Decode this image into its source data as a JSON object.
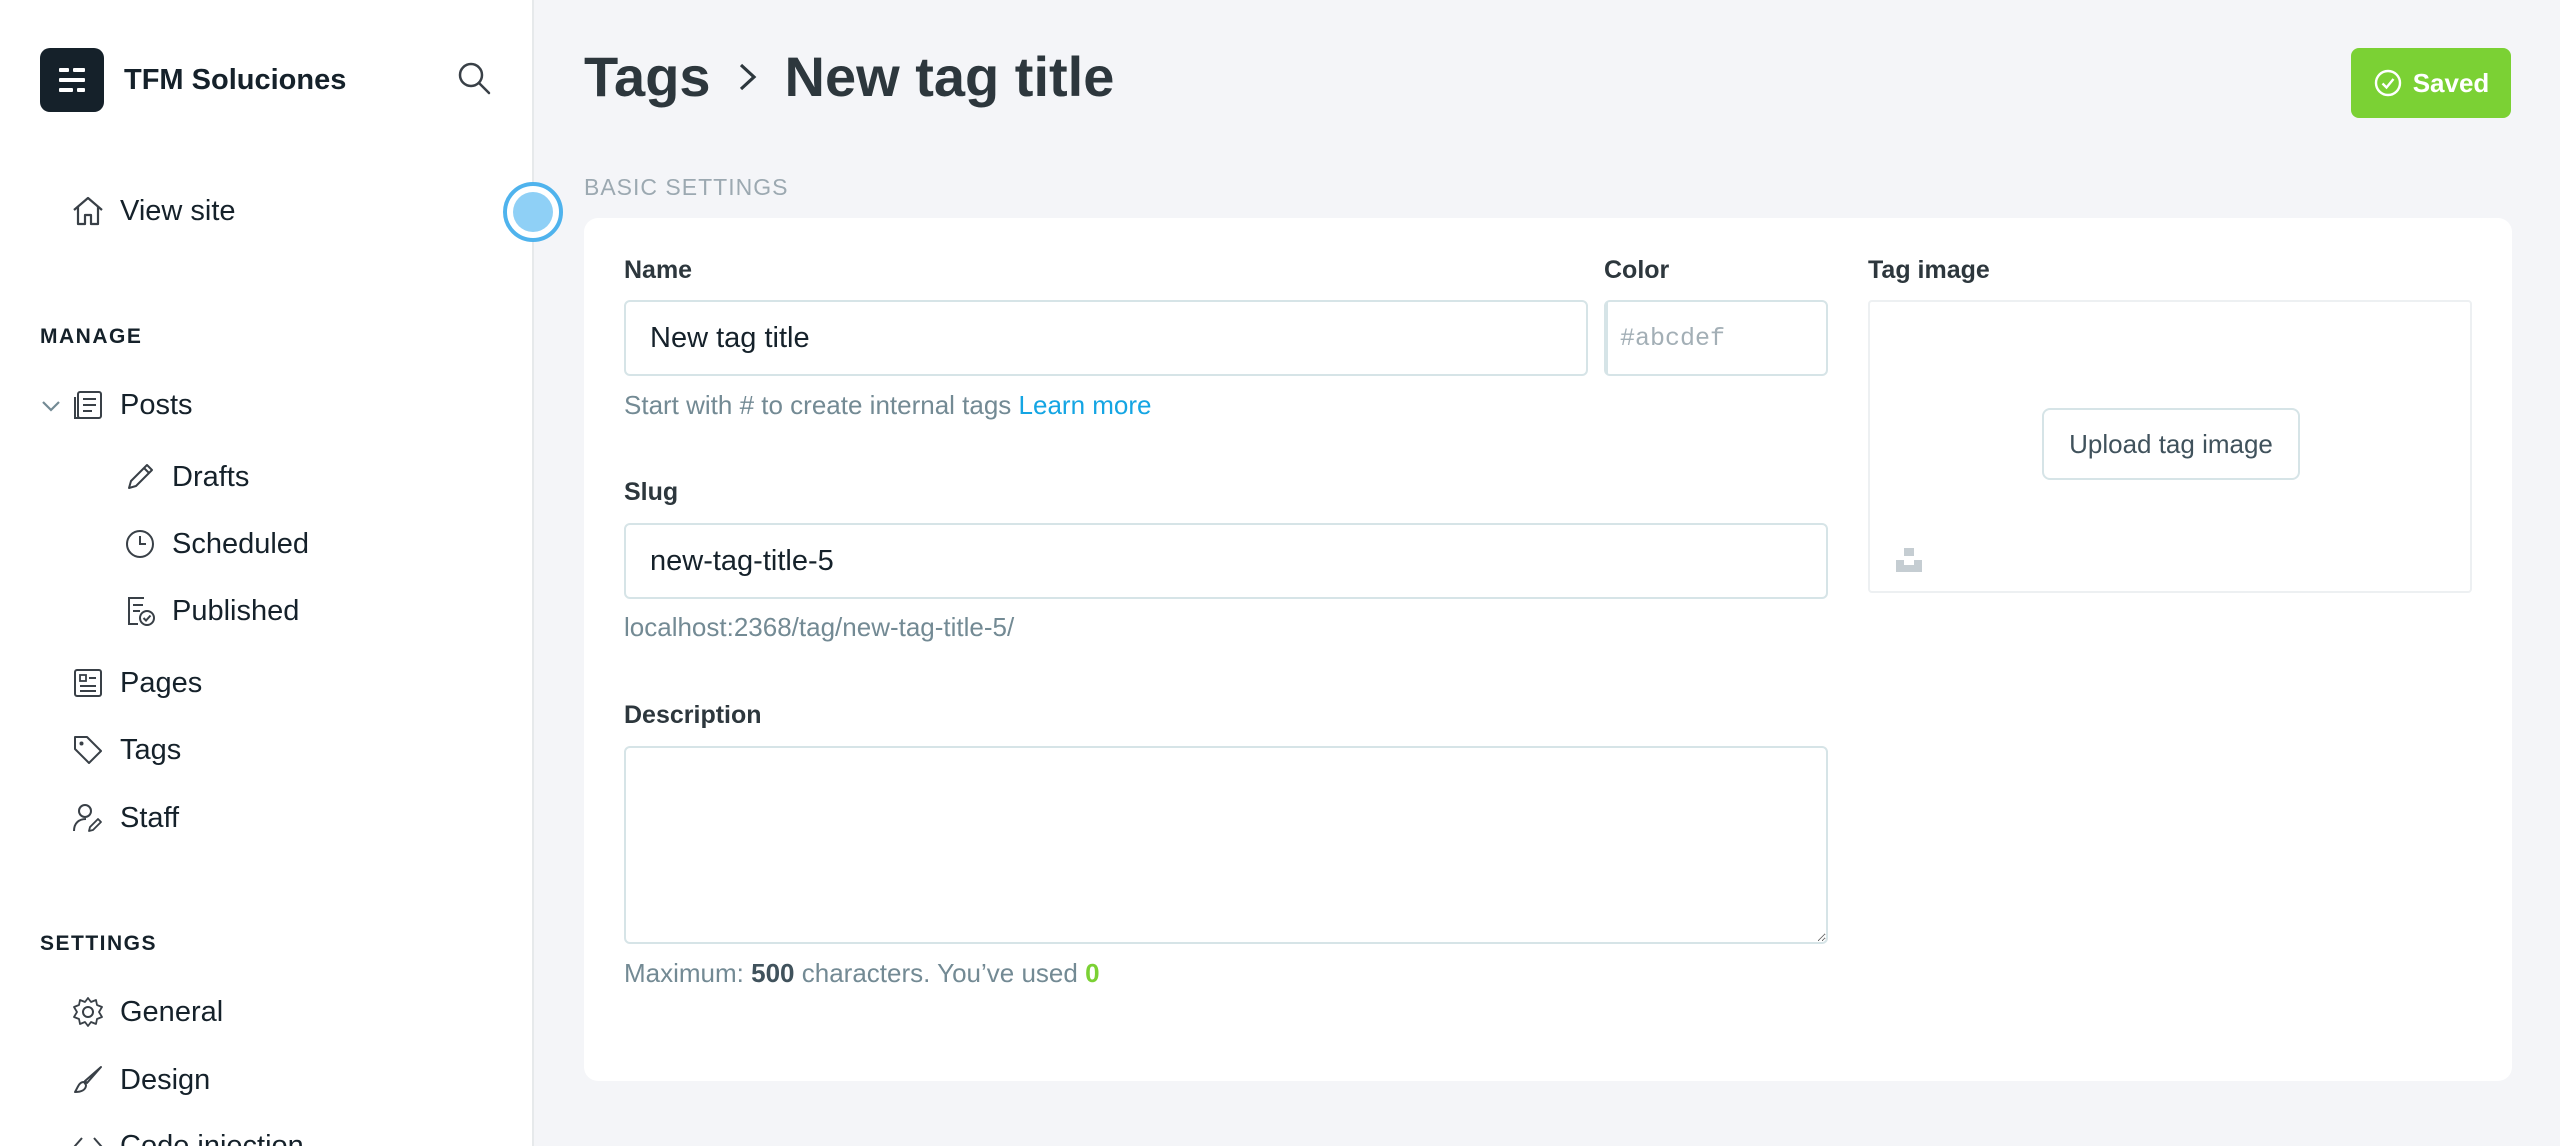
{
  "brand": {
    "name": "TFM Soluciones"
  },
  "sidebar": {
    "view_site": "View site",
    "manage_label": "MANAGE",
    "posts": "Posts",
    "drafts": "Drafts",
    "scheduled": "Scheduled",
    "published": "Published",
    "pages": "Pages",
    "tags": "Tags",
    "staff": "Staff",
    "settings_label": "SETTINGS",
    "general": "General",
    "design": "Design",
    "code_injection": "Code injection"
  },
  "header": {
    "breadcrumb_parent": "Tags",
    "title": "New tag title",
    "saved_label": "Saved"
  },
  "section": {
    "basic_settings": "BASIC SETTINGS"
  },
  "form": {
    "name_label": "Name",
    "name_value": "New tag title",
    "name_hint": "Start with # to create internal tags",
    "learn_more": "Learn more",
    "color_label": "Color",
    "color_placeholder": "#abcdef",
    "tag_image_label": "Tag image",
    "upload_label": "Upload tag image",
    "slug_label": "Slug",
    "slug_value": "new-tag-title-5",
    "slug_url": "localhost:2368/tag/new-tag-title-5/",
    "description_label": "Description",
    "description_value": "",
    "max_prefix": "Maximum:",
    "max_count": "500",
    "max_mid": "characters. You’ve used",
    "used_count": "0"
  },
  "colors": {
    "accent_green": "#7bd134",
    "link_blue": "#14a5e3",
    "sidebar_text": "#15212a"
  }
}
